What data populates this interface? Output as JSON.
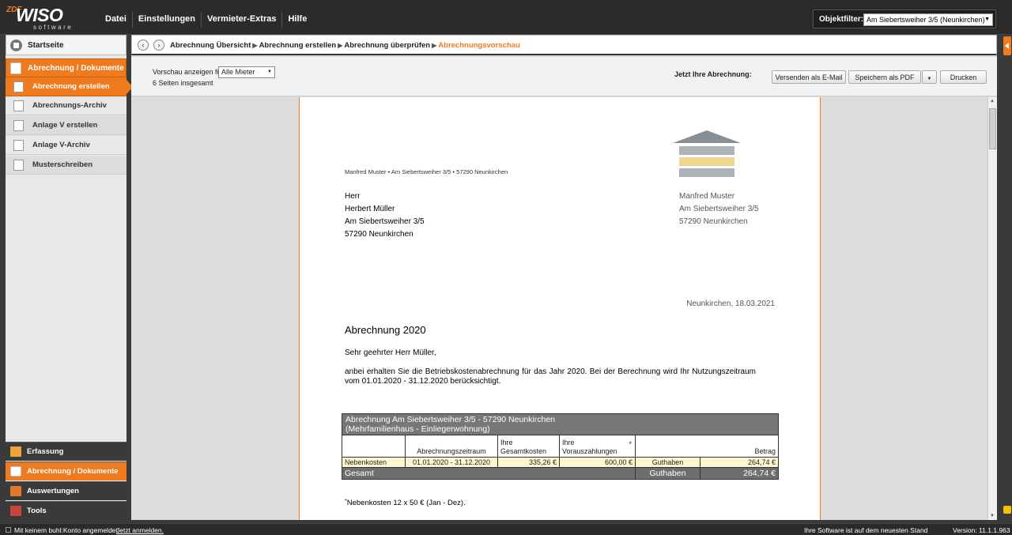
{
  "app": {
    "logo_prefix": "ZDF",
    "logo": "WISO",
    "logo_sub": "software",
    "menu": [
      "Datei",
      "Einstellungen",
      "Vermieter-Extras",
      "Hilfe"
    ],
    "objektfilter_label": "Objektfilter:",
    "objektfilter_value": "Am Siebertsweiher 3/5 (Neunkirchen)"
  },
  "sidebar": {
    "start": "Startseite",
    "section": "Abrechnung / Dokumente",
    "items": [
      {
        "label": "Abrechnung erstellen",
        "active": true
      },
      {
        "label": "Abrechnungs-Archiv",
        "active": false
      },
      {
        "label": "Anlage V erstellen",
        "active": false
      },
      {
        "label": "Anlage V-Archiv",
        "active": false
      },
      {
        "label": "Musterschreiben",
        "active": false
      }
    ],
    "bottom": [
      {
        "label": "Erfassung",
        "color": "#e9a43a"
      },
      {
        "label": "Abrechnung / Dokumente",
        "color": "#ffffff"
      },
      {
        "label": "Auswertungen",
        "color": "#e07a2a"
      },
      {
        "label": "Tools",
        "color": "#c6453c"
      }
    ]
  },
  "breadcrumb": [
    "Abrechnung Übersicht",
    "Abrechnung erstellen",
    "Abrechnung überprüfen",
    "Abrechnungsvorschau"
  ],
  "toolbar": {
    "preview_label": "Vorschau anzeigen für:",
    "preview_value": "Alle Mieter",
    "pages": "6 Seiten insgesamt",
    "now_label": "Jetzt Ihre Abrechnung:",
    "email_btn": "Versenden als E-Mail",
    "pdf_btn": "Speichern als PDF",
    "print_btn": "Drucken"
  },
  "letter": {
    "sender_line": "Manfred  Muster • Am Siebertsweiher 3/5 • 57290 Neunkirchen",
    "recipient": [
      "Herr",
      "Herbert Müller",
      "Am Siebertsweiher 3/5",
      "57290 Neunkirchen"
    ],
    "landlord": [
      "Manfred  Muster",
      "Am Siebertsweiher 3/5",
      "57290 Neunkirchen"
    ],
    "date": "Neunkirchen, 18.03.2021",
    "subject": "Abrechnung 2020",
    "greeting": "Sehr geehrter Herr Müller,",
    "body": "anbei erhalten Sie die Betriebskostenabrechnung für das Jahr 2020.  Bei der Berechnung wird Ihr Nutzungszeitraum vom 01.01.2020 - 31.12.2020 berücksichtigt.",
    "footnote": "Nebenkosten  12 x 50 € (Jan - Dez)."
  },
  "table": {
    "title1": "Abrechnung Am Siebertsweiher 3/5 - 57290 Neunkirchen",
    "title2": "(Mehrfamilienhaus - Einliegerwohnung)",
    "col_zeitraum": "Abrechnungszeitraum",
    "col_gesamt1": "Ihre",
    "col_gesamt2": "Gesamtkosten",
    "col_voraus1": "Ihre",
    "col_voraus2": "Vorauszahlungen",
    "col_voraus_mark": "*",
    "col_betrag": "Betrag",
    "row_label": "Nebenkosten",
    "row_zeitraum": "01.01.2020 - 31.12.2020",
    "row_gesamt": "335,26 €",
    "row_voraus": "600,00 €",
    "row_type": "Guthaben",
    "row_betrag": "264,74 €",
    "total_label": "Gesamt",
    "total_type": "Guthaben",
    "total_betrag": "264,74 €"
  },
  "status": {
    "login": "Mit keinem buhl:Konto angemeldet.",
    "login_link": "Jetzt anmelden.",
    "uptodate": "Ihre Software ist auf dem neuesten Stand",
    "version": "Version: 11.1.1.963"
  }
}
